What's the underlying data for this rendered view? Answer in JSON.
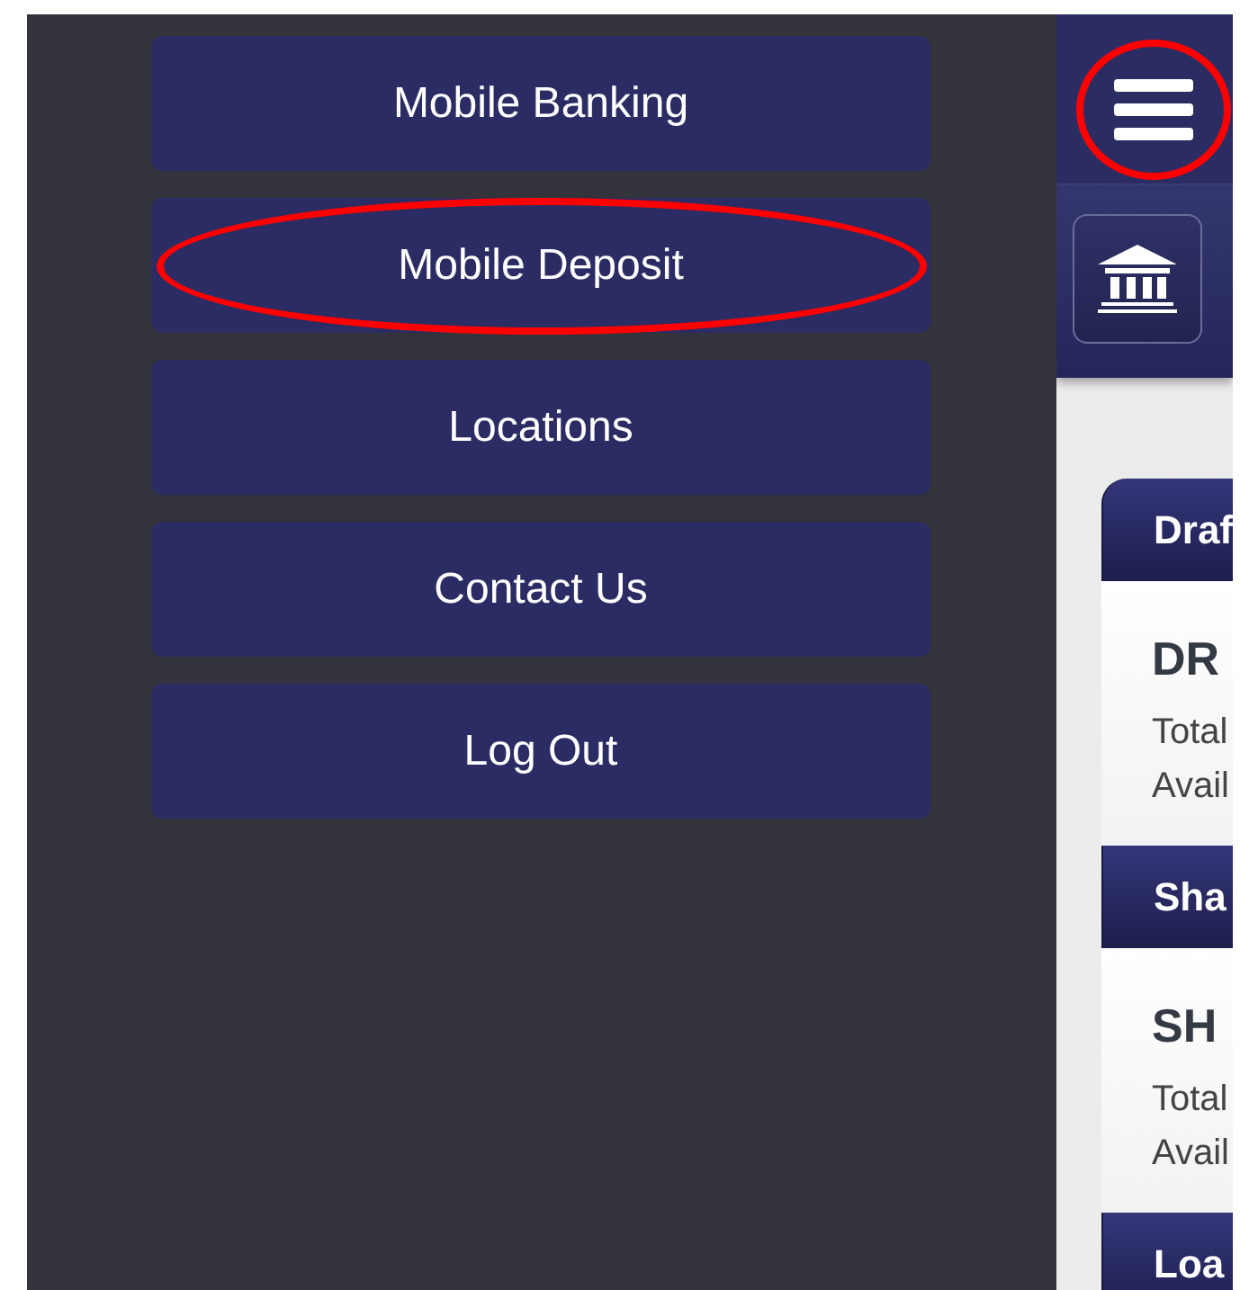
{
  "menu": [
    {
      "label": "Mobile Banking",
      "circled": false
    },
    {
      "label": "Mobile Deposit",
      "circled": true
    },
    {
      "label": "Locations",
      "circled": false
    },
    {
      "label": "Contact Us",
      "circled": false
    },
    {
      "label": "Log Out",
      "circled": false
    }
  ],
  "top_bar": {
    "menu_button": {
      "circled": true
    }
  },
  "accounts": [
    {
      "header": "Draf",
      "name": "DR",
      "lines": [
        "Total",
        "Avail"
      ]
    },
    {
      "header": "Sha",
      "name": "SH",
      "lines": [
        "Total",
        "Avail"
      ]
    },
    {
      "header": "Loa"
    }
  ]
}
